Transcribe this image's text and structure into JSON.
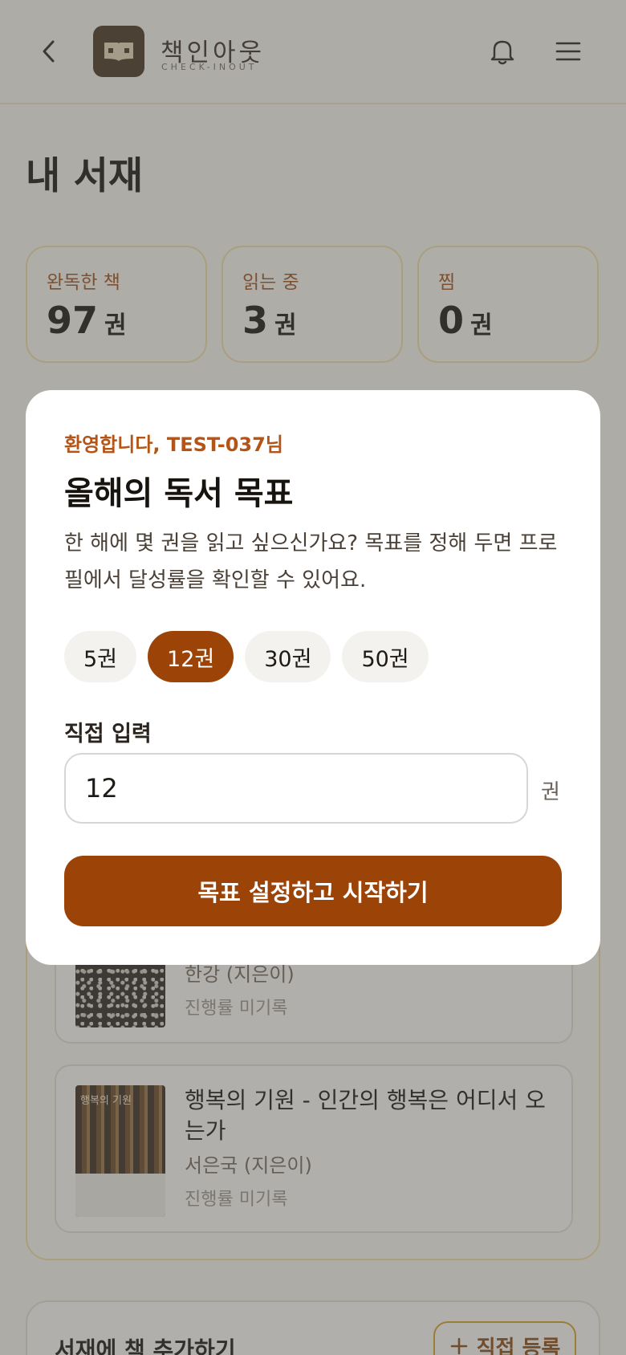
{
  "header": {
    "logo_title": "책인아웃",
    "logo_subtitle": "CHECK-INOUT",
    "icons": {
      "back": "chevron-left-icon",
      "logo": "book-icon",
      "bell": "bell-icon",
      "menu": "menu-icon"
    }
  },
  "page_title": "내 서재",
  "stats": [
    {
      "label": "완독한 책",
      "value": "97",
      "unit": "권"
    },
    {
      "label": "읽는 중",
      "value": "3",
      "unit": "권"
    },
    {
      "label": "찜",
      "value": "0",
      "unit": "권"
    }
  ],
  "books": [
    {
      "title": "",
      "author": "한강 (지은이)",
      "progress": "진행률 미기록"
    },
    {
      "title": "행복의 기원 - 인간의 행복은 어디서 오는가",
      "author": "서은국 (지은이)",
      "progress": "진행률 미기록",
      "cover_text": "행복의 기원"
    }
  ],
  "add_section": {
    "title": "서재에 책 추가하기",
    "direct_button": "직접 등록",
    "direct_icon": "plus-icon"
  },
  "modal": {
    "welcome": "환영합니다, TEST-037님",
    "title": "올해의 독서 목표",
    "description": "한 해에 몇 권을 읽고 싶으신가요? 목표를 정해 두면 프로필에서 달성률을 확인할 수 있어요.",
    "chips": [
      "5권",
      "12권",
      "30권",
      "50권"
    ],
    "selected_chip": "12권",
    "input_label": "직접 입력",
    "input_value": "12",
    "input_unit": "권",
    "submit_label": "목표 설정하고 시작하기"
  },
  "colors": {
    "accent": "#9c4308",
    "accent_text": "#b45416",
    "border_gold": "#f3dfa3",
    "background": "#fbf8ef"
  }
}
